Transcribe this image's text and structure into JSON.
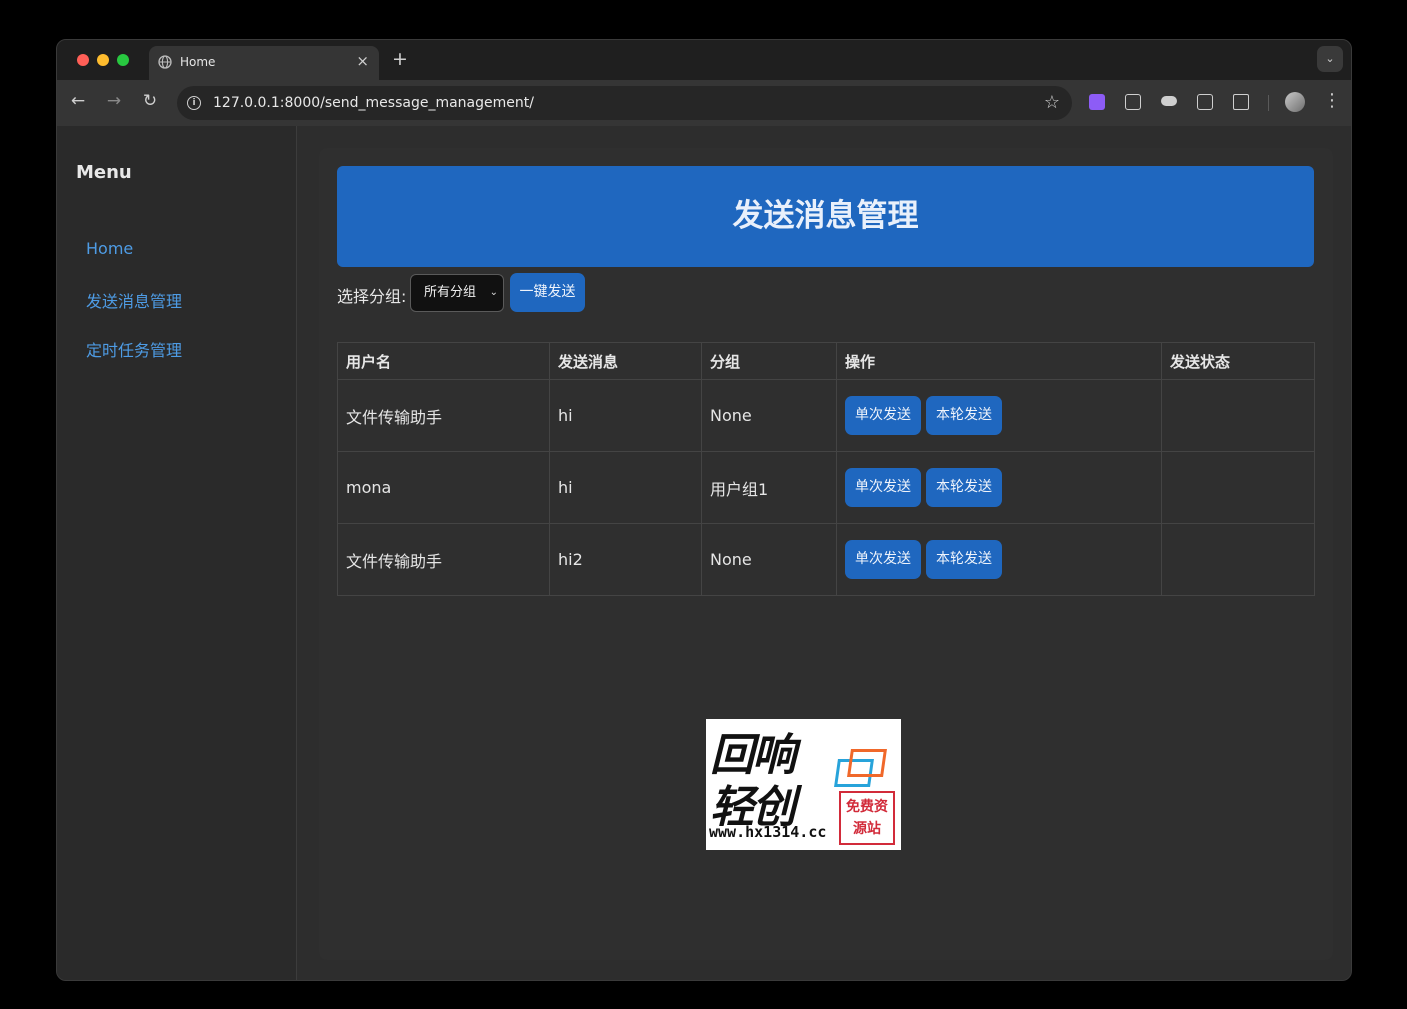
{
  "browser": {
    "tab_title": "Home",
    "tab_close": "×",
    "new_tab": "+",
    "tab_menu": "⌄",
    "url": "127.0.0.1:8000/send_message_management/",
    "back": "←",
    "forward": "→",
    "reload": "↻",
    "star": "☆",
    "menu": "⋮",
    "info": "i"
  },
  "sidebar": {
    "title": "Menu",
    "links": [
      "Home",
      "发送消息管理",
      "定时任务管理"
    ],
    "link_color": "#4e9ce5"
  },
  "main": {
    "banner_title": "发送消息管理",
    "group_label": "选择分组:",
    "group_select_value": "所有分组",
    "send_all_label": "一键发送",
    "accent_color": "#1f67bf"
  },
  "table": {
    "headers": [
      "用户名",
      "发送消息",
      "分组",
      "操作",
      "发送状态"
    ],
    "rows": [
      {
        "user": "文件传输助手",
        "message": "hi",
        "group": "None",
        "status": ""
      },
      {
        "user": "mona",
        "message": "hi",
        "group": "用户组1",
        "status": ""
      },
      {
        "user": "文件传输助手",
        "message": "hi2",
        "group": "None",
        "status": ""
      }
    ],
    "single_send_label": "单次发送",
    "round_send_label": "本轮发送"
  },
  "watermark": {
    "line1": "回响",
    "line2": "轻创",
    "url": "www.hx1314.cc",
    "stamp": "免费资源站"
  }
}
